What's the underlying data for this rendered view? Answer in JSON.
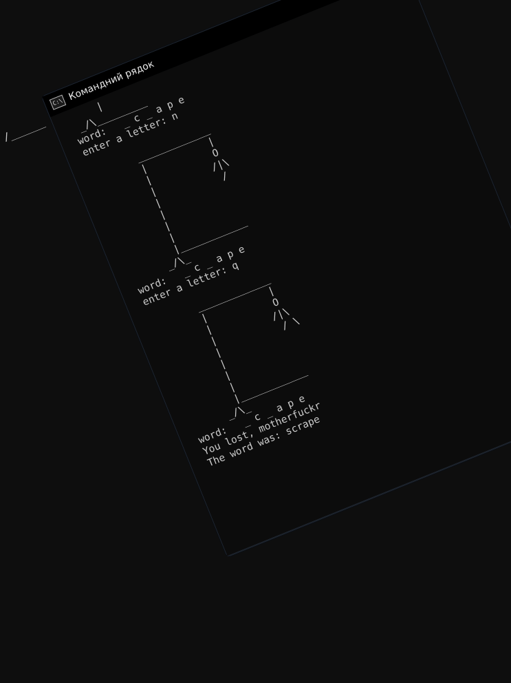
{
  "stray_text": "/______",
  "window": {
    "title": "Командний рядок",
    "icon_text": "C:\\"
  },
  "console": {
    "lines": [
      "     |",
      " _/\\_________",
      "word:   _ c _ a p e",
      "enter a letter: n",
      "",
      "        _____________",
      "        |           |",
      "        |           O",
      "        |          /|\\",
      "        |           /",
      "        |",
      "        |",
      "        |",
      "        |____________",
      "      _/\\_",
      "word:   _ c _ a p e",
      "enter a letter: q",
      "",
      "        _____________",
      "        |           |",
      "        |           O",
      "        |          /|\\",
      "        |           / \\",
      "        |",
      "        |",
      "        |",
      "        |____________",
      "      _/\\_",
      "word:   _ c _ a p e",
      "You lost, motherfuckr",
      "The word was: scrape"
    ]
  }
}
